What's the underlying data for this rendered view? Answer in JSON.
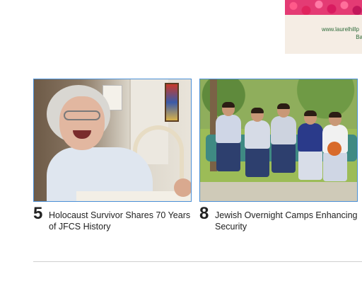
{
  "top_partial_text": "",
  "ad": {
    "url": "www.laurelhillp",
    "line2": "Ba"
  },
  "articles": [
    {
      "rank": "5",
      "title": "Holocaust Survivor Shares 70 Years of JFCS History",
      "image_alt": "Elderly woman smiling"
    },
    {
      "rank": "8",
      "title": "Jewish Overnight Camps Enhancing Security",
      "image_alt": "Five boys sitting on a bench"
    }
  ],
  "colors": {
    "thumb_border": "#4a8fd6",
    "ad_text": "#2e6b3a",
    "ad_flowers": "#e43b74"
  }
}
